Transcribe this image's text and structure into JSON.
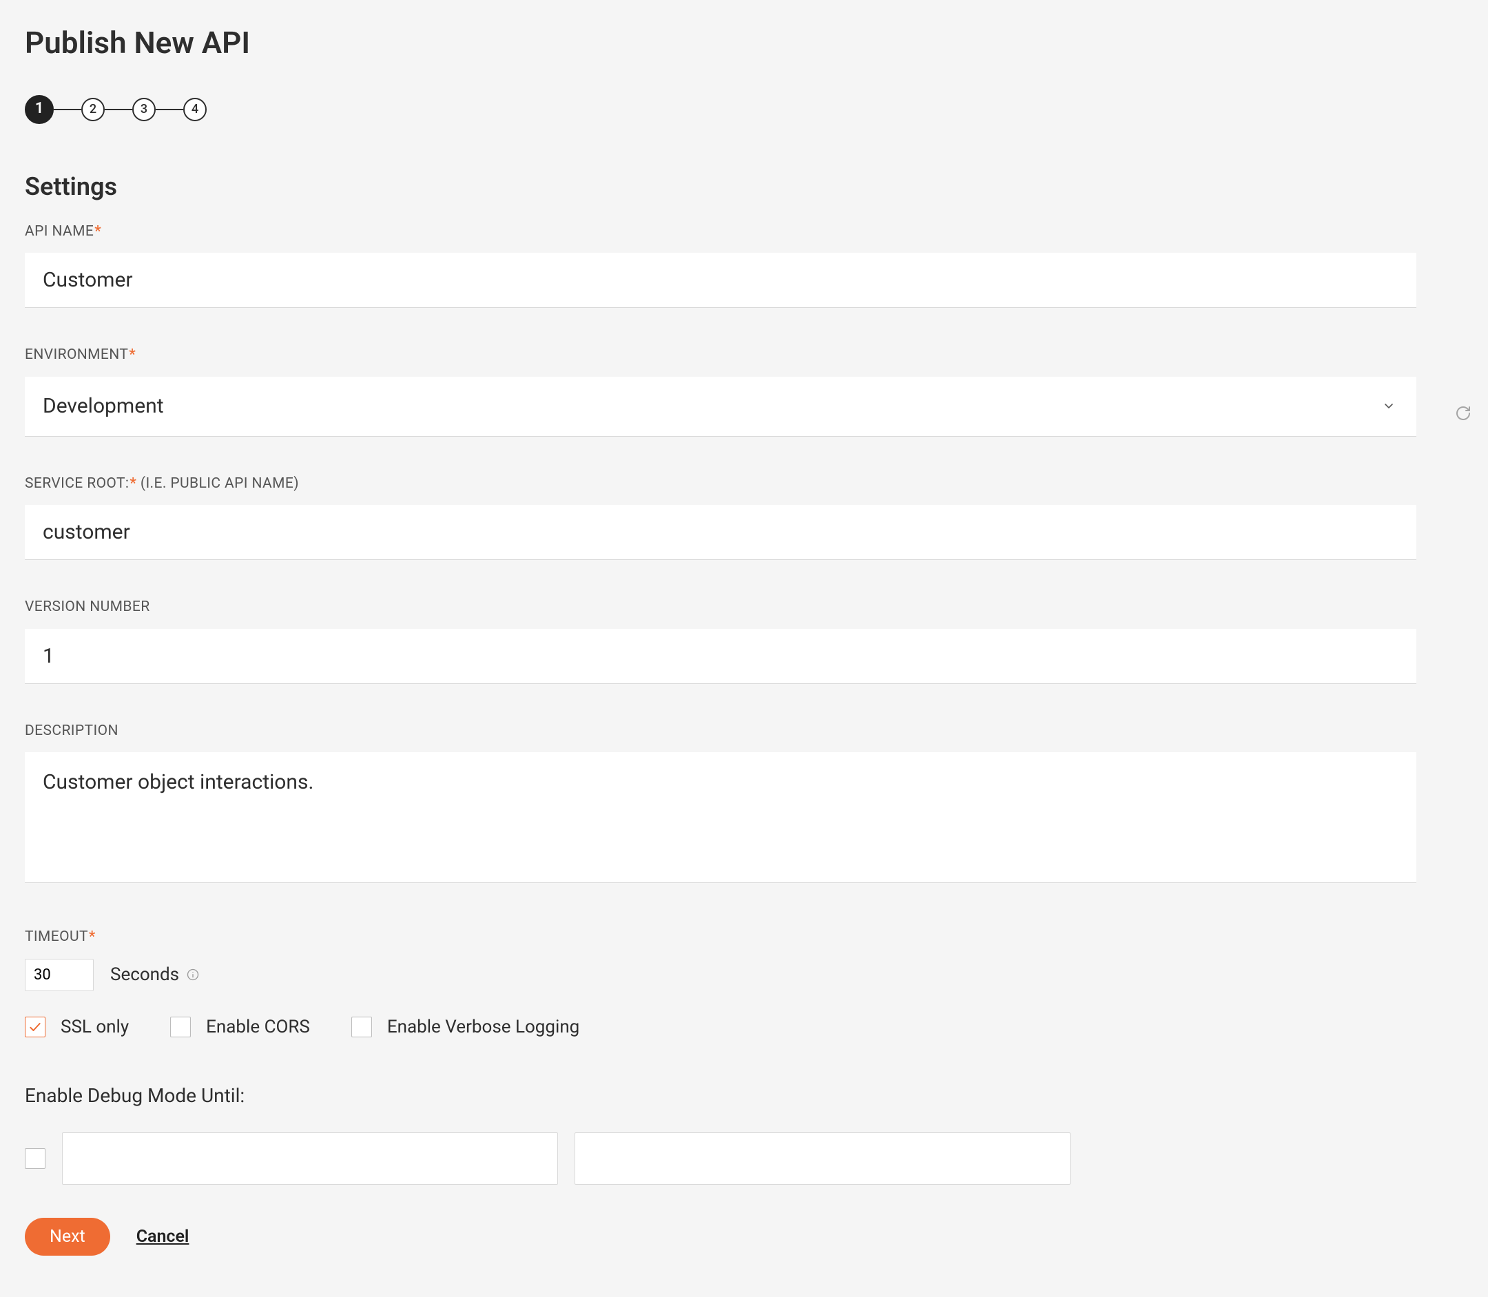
{
  "header": {
    "title": "Publish New API"
  },
  "stepper": {
    "steps": [
      "1",
      "2",
      "3",
      "4"
    ],
    "active_index": 0
  },
  "section": {
    "heading": "Settings"
  },
  "fields": {
    "api_name": {
      "label": "API NAME",
      "required": true,
      "value": "Customer"
    },
    "environment": {
      "label": "ENVIRONMENT",
      "required": true,
      "value": "Development"
    },
    "service_root": {
      "label": "SERVICE ROOT:",
      "required": true,
      "hint": " (I.E. PUBLIC API NAME)",
      "value": "customer"
    },
    "version": {
      "label": "VERSION NUMBER",
      "required": false,
      "value": "1"
    },
    "description": {
      "label": "DESCRIPTION",
      "required": false,
      "value": "Customer object interactions."
    },
    "timeout": {
      "label": "TIMEOUT",
      "required": true,
      "value": "30",
      "unit": "Seconds"
    }
  },
  "checkboxes": {
    "ssl_only": {
      "label": "SSL only",
      "checked": true
    },
    "cors": {
      "label": "Enable CORS",
      "checked": false
    },
    "verbose": {
      "label": "Enable Verbose Logging",
      "checked": false
    }
  },
  "debug": {
    "label": "Enable Debug Mode Until:",
    "checked": false,
    "value1": "",
    "value2": ""
  },
  "actions": {
    "primary": "Next",
    "cancel": "Cancel"
  }
}
